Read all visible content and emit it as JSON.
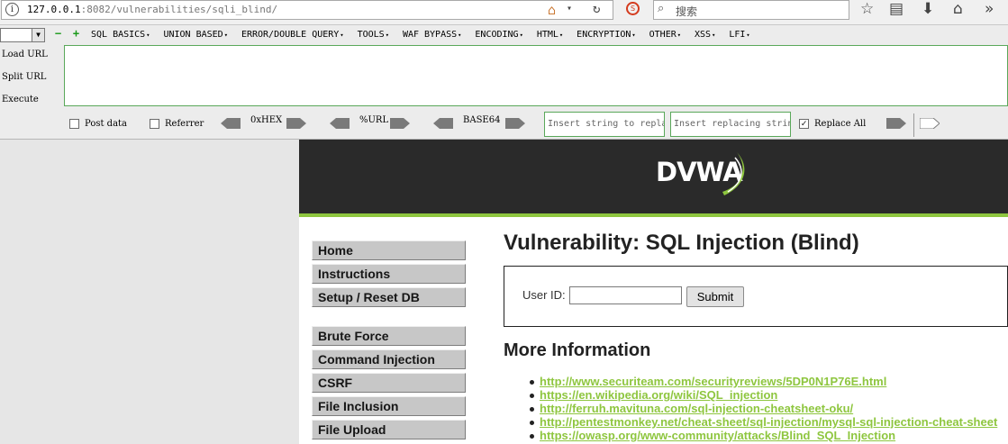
{
  "browser": {
    "url_host": "127.0.0.1",
    "url_rest": ":8082/vulnerabilities/sqli_blind/",
    "search_placeholder": "搜索"
  },
  "hackbar": {
    "menus": [
      "SQL BASICS",
      "UNION BASED",
      "ERROR/DOUBLE QUERY",
      "TOOLS",
      "WAF BYPASS",
      "ENCODING",
      "HTML",
      "ENCRYPTION",
      "OTHER",
      "XSS",
      "LFI"
    ],
    "load_url": "Load URL",
    "split_url": "Split URL",
    "execute": "Execute",
    "post_data": "Post data",
    "referrer": "Referrer",
    "hex": "0xHEX",
    "url_enc": "%URL",
    "base64": "BASE64",
    "insert_string_placeholder": "Insert string to replace",
    "insert_replacing_placeholder": "Insert replacing string",
    "replace_all": "Replace All",
    "replace_all_checked": true
  },
  "dvwa": {
    "logo": "DVWA",
    "accent": "#8ec63f",
    "menu_group1": [
      "Home",
      "Instructions",
      "Setup / Reset DB"
    ],
    "menu_group2": [
      "Brute Force",
      "Command Injection",
      "CSRF",
      "File Inclusion",
      "File Upload"
    ],
    "page_title": "Vulnerability: SQL Injection (Blind)",
    "userid_label": "User ID:",
    "userid_value": "",
    "submit_label": "Submit",
    "more_info_title": "More Information",
    "links": [
      "http://www.securiteam.com/securityreviews/5DP0N1P76E.html",
      "https://en.wikipedia.org/wiki/SQL_injection",
      "http://ferruh.mavituna.com/sql-injection-cheatsheet-oku/",
      "http://pentestmonkey.net/cheat-sheet/sql-injection/mysql-sql-injection-cheat-sheet",
      "https://owasp.org/www-community/attacks/Blind_SQL_Injection"
    ]
  }
}
